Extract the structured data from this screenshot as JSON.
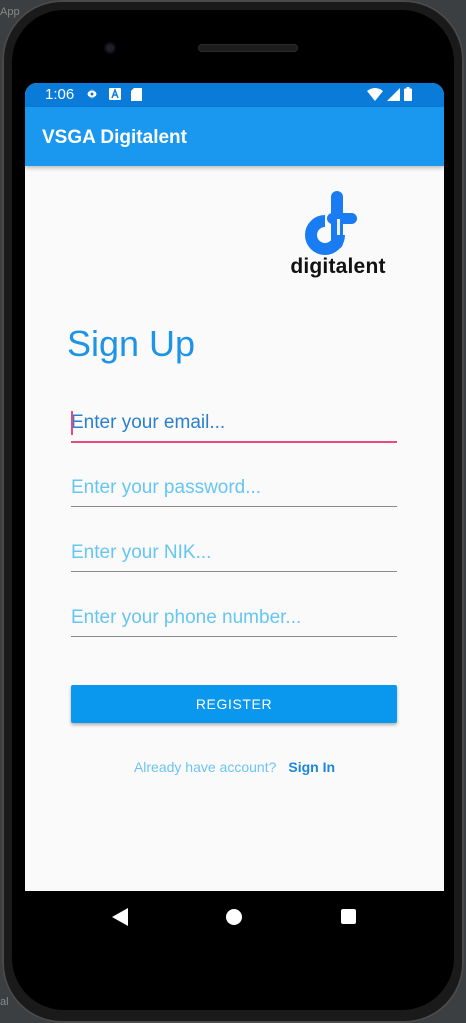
{
  "editor_edge": {
    "top_fragment": "App",
    "bottom_fragment": "al"
  },
  "status_bar": {
    "time": "1:06",
    "left_icons": [
      "settings-gear-icon",
      "notification-a-icon",
      "sd-card-icon"
    ],
    "right_icons": [
      "wifi-icon",
      "cell-signal-icon",
      "battery-icon"
    ]
  },
  "app_bar": {
    "title": "VSGA Digitalent"
  },
  "logo": {
    "text": "digitalent",
    "accent_color": "#1a7cf2"
  },
  "form": {
    "heading": "Sign Up",
    "fields": [
      {
        "name": "email",
        "placeholder": "Enter your email...",
        "focused": true
      },
      {
        "name": "password",
        "placeholder": "Enter your password...",
        "focused": false
      },
      {
        "name": "nik",
        "placeholder": "Enter your NIK...",
        "focused": false
      },
      {
        "name": "phone",
        "placeholder": "Enter your phone number...",
        "focused": false
      }
    ],
    "register_label": "REGISTER",
    "signin_prompt": "Already have account?",
    "signin_link": "Sign In"
  },
  "colors": {
    "status_bar": "#0a7bd8",
    "app_bar": "#1a98f0",
    "primary": "#0a98ee",
    "heading": "#1e94e6",
    "focus_underline": "#e84a7f"
  },
  "nav_bar": {
    "buttons": [
      "back-icon",
      "home-icon",
      "recents-icon"
    ]
  }
}
